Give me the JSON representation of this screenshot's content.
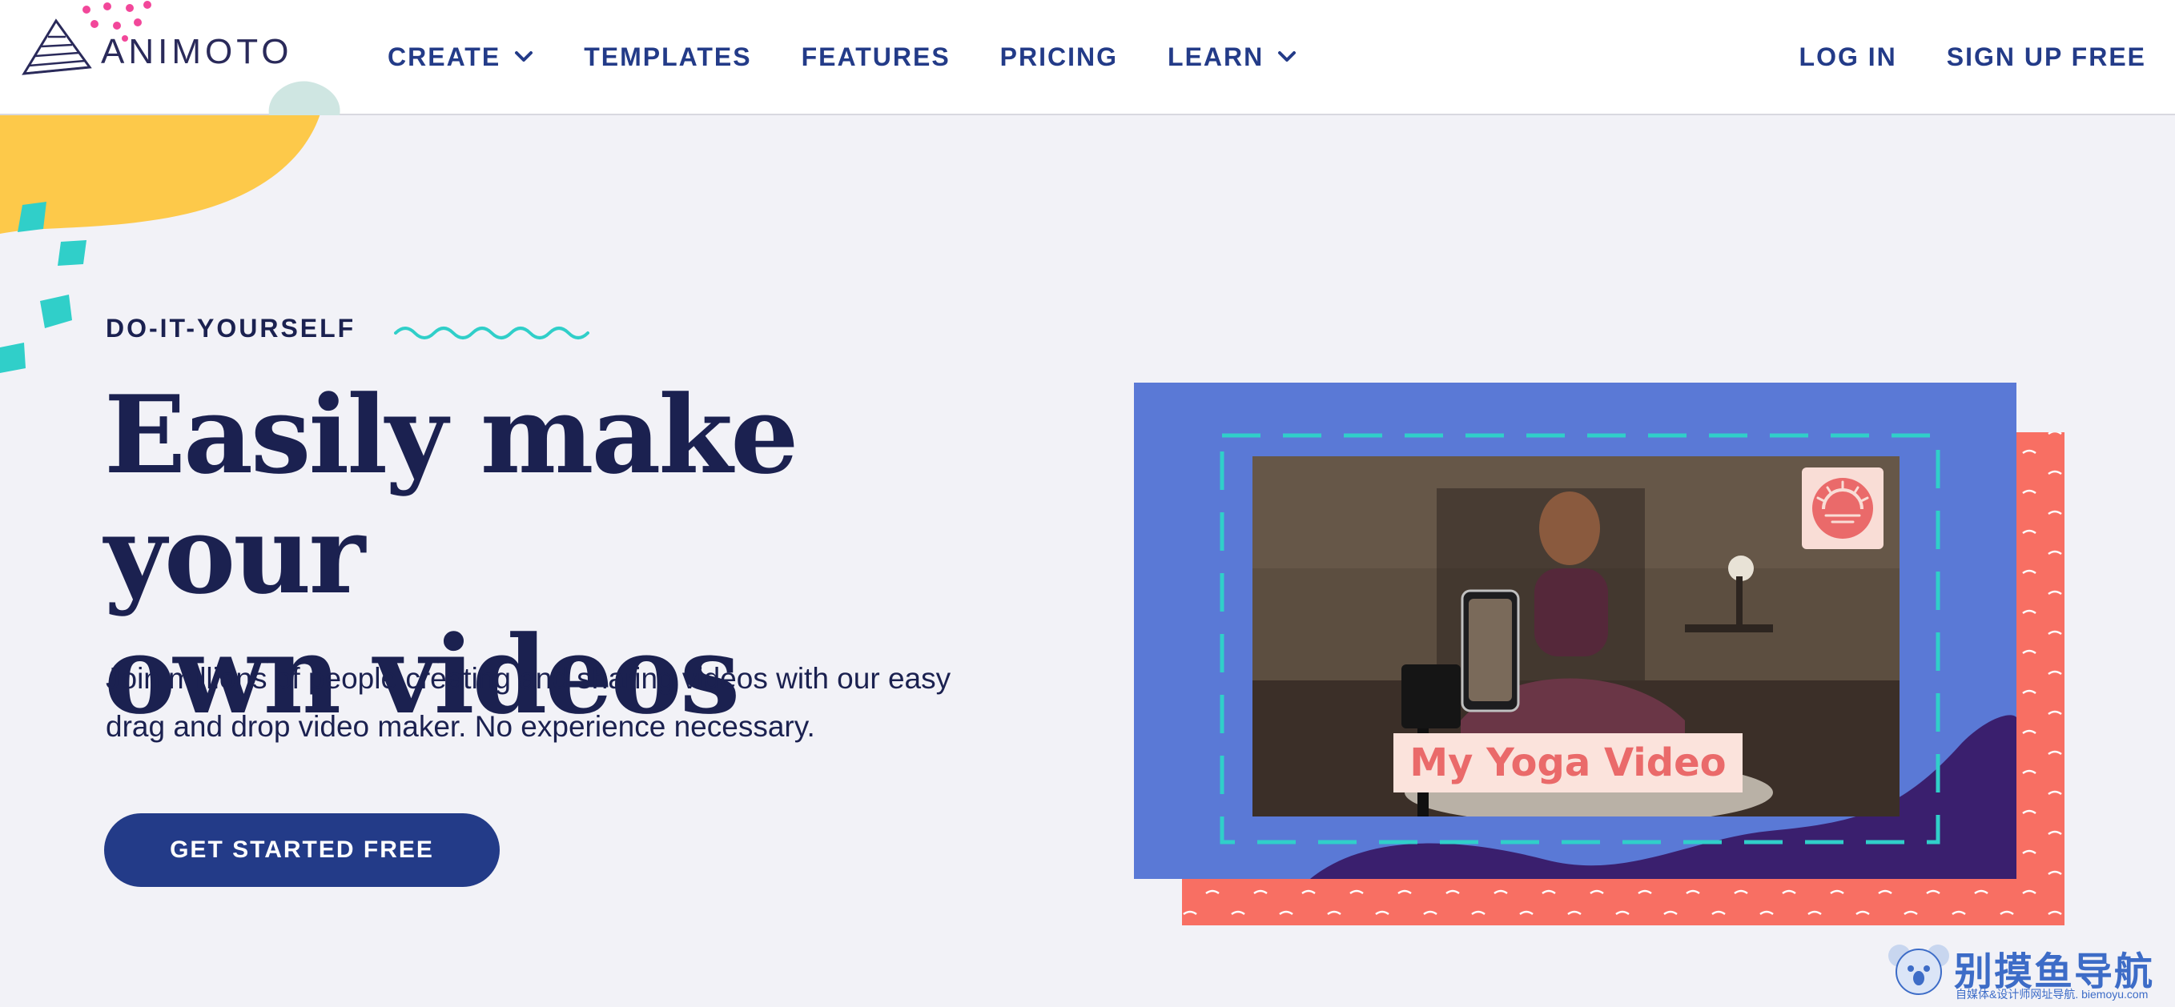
{
  "header": {
    "logo_text": "ANIMOTO",
    "nav_left": [
      {
        "label": "CREATE",
        "has_dropdown": true
      },
      {
        "label": "TEMPLATES",
        "has_dropdown": false
      },
      {
        "label": "FEATURES",
        "has_dropdown": false
      },
      {
        "label": "PRICING",
        "has_dropdown": false
      },
      {
        "label": "LEARN",
        "has_dropdown": true
      }
    ],
    "nav_right": [
      {
        "label": "LOG IN"
      },
      {
        "label": "SIGN UP FREE"
      }
    ]
  },
  "hero": {
    "eyebrow": "DO-IT-YOURSELF",
    "headline_line1": "Easily make your",
    "headline_line2": "own videos",
    "subtext_line1": "Join millions of people creating and sharing videos with our easy",
    "subtext_line2": "drag and drop video maker. No experience necessary.",
    "cta_label": "GET STARTED FREE",
    "video_title": "My Yoga Video"
  },
  "watermark": {
    "title": "别摸鱼导航",
    "subtitle": "自媒体&设计师网址导航. biemoyu.com"
  },
  "colors": {
    "navy": "#1b2150",
    "brand_blue": "#233b88",
    "frame_blue": "#5a79d6",
    "coral": "#f86f63",
    "purple": "#3a1f6e",
    "teal": "#30cfc9",
    "yellow": "#fdc94a"
  }
}
